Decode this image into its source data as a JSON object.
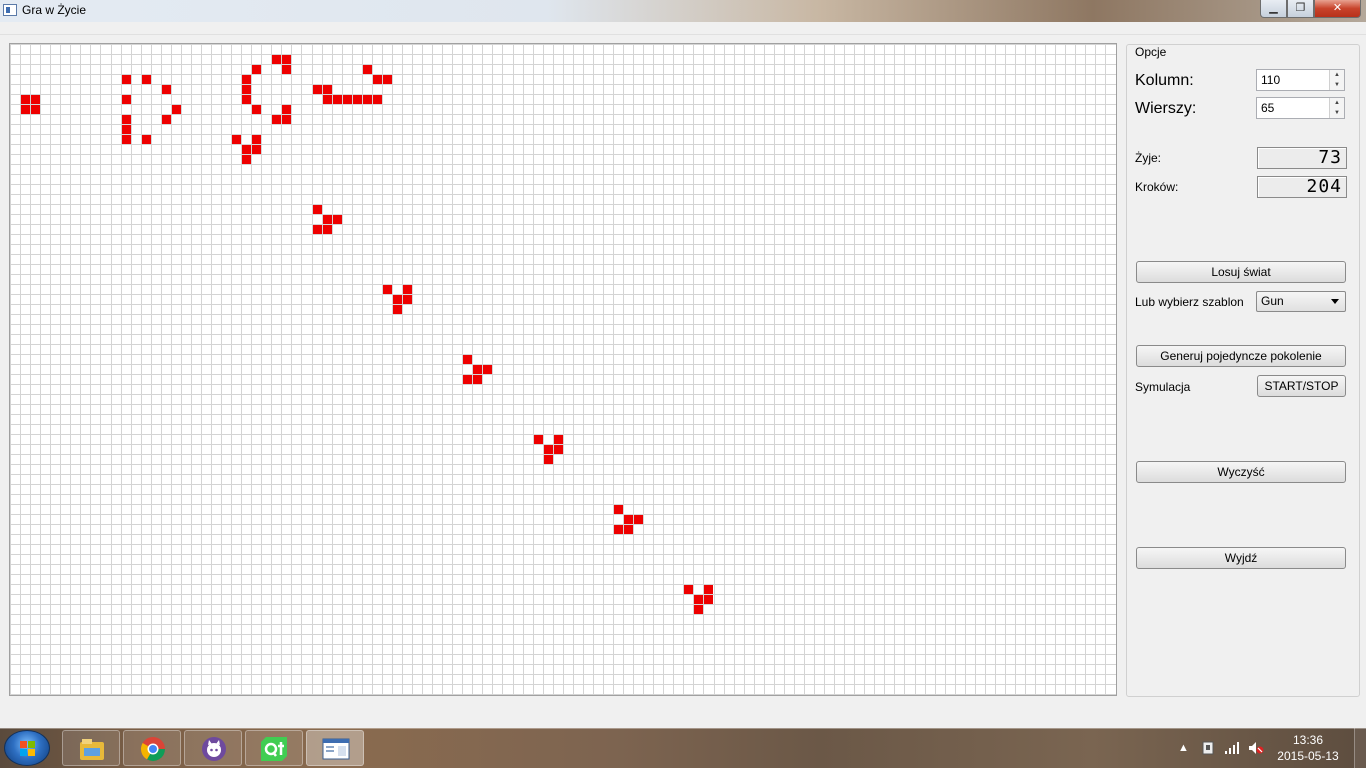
{
  "window": {
    "title": "Gra w Życie",
    "minimize_glyph": "▁",
    "maximize_glyph": "❐",
    "close_glyph": "✕"
  },
  "grid": {
    "columns": 110,
    "rows": 65,
    "grid_line_color": "#d4d4d4",
    "live_cell_color": "#ee0000",
    "live_cells": [
      [
        1,
        5
      ],
      [
        2,
        5
      ],
      [
        1,
        6
      ],
      [
        2,
        6
      ],
      [
        11,
        3
      ],
      [
        13,
        3
      ],
      [
        15,
        4
      ],
      [
        11,
        5
      ],
      [
        16,
        6
      ],
      [
        11,
        7
      ],
      [
        15,
        7
      ],
      [
        11,
        8
      ],
      [
        13,
        9
      ],
      [
        11,
        9
      ],
      [
        26,
        1
      ],
      [
        27,
        1
      ],
      [
        24,
        2
      ],
      [
        27,
        2
      ],
      [
        23,
        3
      ],
      [
        23,
        4
      ],
      [
        23,
        5
      ],
      [
        24,
        6
      ],
      [
        27,
        6
      ],
      [
        26,
        7
      ],
      [
        27,
        7
      ],
      [
        35,
        2
      ],
      [
        30,
        4
      ],
      [
        31,
        4
      ],
      [
        36,
        3
      ],
      [
        37,
        3
      ],
      [
        31,
        5
      ],
      [
        32,
        5
      ],
      [
        33,
        5
      ],
      [
        34,
        5
      ],
      [
        35,
        5
      ],
      [
        36,
        5
      ],
      [
        22,
        9
      ],
      [
        24,
        9
      ],
      [
        23,
        10
      ],
      [
        24,
        10
      ],
      [
        23,
        11
      ],
      [
        30,
        16
      ],
      [
        31,
        17
      ],
      [
        32,
        17
      ],
      [
        30,
        18
      ],
      [
        31,
        18
      ],
      [
        37,
        24
      ],
      [
        39,
        24
      ],
      [
        38,
        25
      ],
      [
        39,
        25
      ],
      [
        38,
        26
      ],
      [
        45,
        31
      ],
      [
        46,
        32
      ],
      [
        47,
        32
      ],
      [
        45,
        33
      ],
      [
        46,
        33
      ],
      [
        52,
        39
      ],
      [
        54,
        39
      ],
      [
        53,
        40
      ],
      [
        54,
        40
      ],
      [
        53,
        41
      ],
      [
        60,
        46
      ],
      [
        61,
        47
      ],
      [
        62,
        47
      ],
      [
        60,
        48
      ],
      [
        61,
        48
      ],
      [
        67,
        54
      ],
      [
        69,
        54
      ],
      [
        68,
        55
      ],
      [
        69,
        55
      ],
      [
        68,
        56
      ]
    ]
  },
  "options": {
    "group_title": "Opcje",
    "columns_label": "Kolumn:",
    "columns_value": "110",
    "rows_label": "Wierszy:",
    "rows_value": "65",
    "alive_label": "Żyje:",
    "alive_value": "73",
    "steps_label": "Kroków:",
    "steps_value": "204",
    "randomize_button": "Losuj świat",
    "template_label": "Lub wybierz szablon",
    "template_selected": "Gun",
    "step_button": "Generuj pojedyncze pokolenie",
    "simulation_label": "Symulacja",
    "startstop_button": "START/STOP",
    "clear_button": "Wyczyść",
    "exit_button": "Wyjdź"
  },
  "taskbar": {
    "apps": [
      "windows-explorer-icon",
      "chrome-icon",
      "github-icon",
      "qt-creator-icon",
      "game-of-life-app-icon"
    ],
    "clock_time": "13:36",
    "clock_date": "2015-05-13",
    "tray_arrow": "▲"
  }
}
